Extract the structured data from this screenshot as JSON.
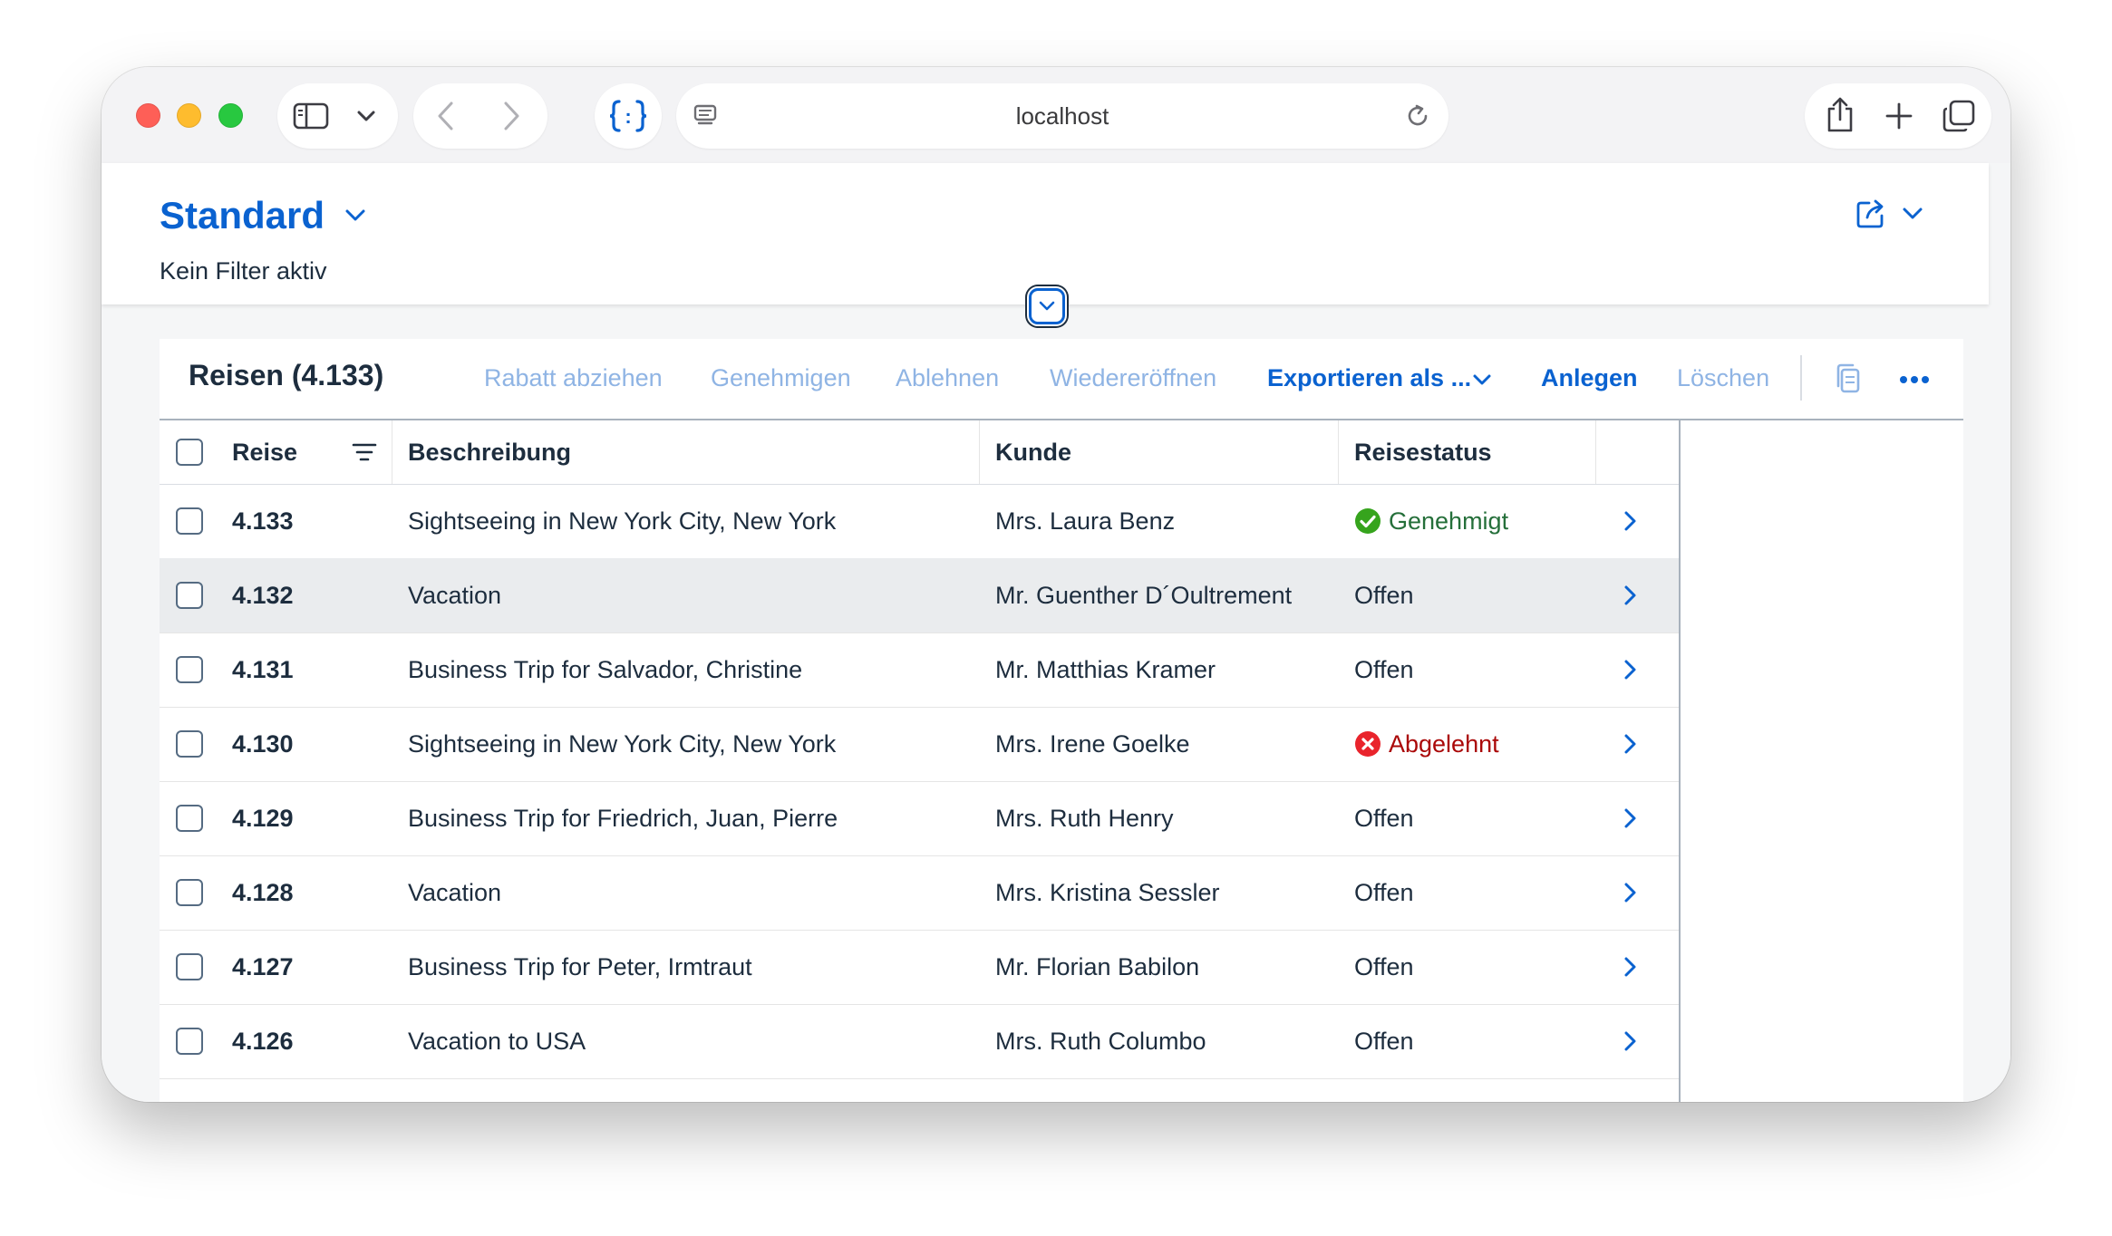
{
  "browser": {
    "address": "localhost"
  },
  "header": {
    "variant_title": "Standard",
    "filter_status": "Kein Filter aktiv"
  },
  "table": {
    "title": "Reisen (4.133)",
    "actions": {
      "discount": "Rabatt abziehen",
      "approve": "Genehmigen",
      "reject": "Ablehnen",
      "reopen": "Wiedereröffnen",
      "export": "Exportieren als ...",
      "create": "Anlegen",
      "delete": "Löschen"
    },
    "columns": {
      "trip": "Reise",
      "description": "Beschreibung",
      "customer": "Kunde",
      "status": "Reisestatus"
    },
    "rows": [
      {
        "id": "4.133",
        "description": "Sightseeing in New York City, New York",
        "customer": "Mrs. Laura Benz",
        "status": "Genehmigt",
        "status_type": "positive"
      },
      {
        "id": "4.132",
        "description": "Vacation",
        "customer": "Mr. Guenther D´Oultrement",
        "status": "Offen",
        "status_type": "neutral"
      },
      {
        "id": "4.131",
        "description": "Business Trip for Salvador, Christine",
        "customer": "Mr. Matthias Kramer",
        "status": "Offen",
        "status_type": "neutral"
      },
      {
        "id": "4.130",
        "description": "Sightseeing in New York City, New York",
        "customer": "Mrs. Irene Goelke",
        "status": "Abgelehnt",
        "status_type": "negative"
      },
      {
        "id": "4.129",
        "description": "Business Trip for Friedrich, Juan, Pierre",
        "customer": "Mrs. Ruth Henry",
        "status": "Offen",
        "status_type": "neutral"
      },
      {
        "id": "4.128",
        "description": "Vacation",
        "customer": "Mrs. Kristina Sessler",
        "status": "Offen",
        "status_type": "neutral"
      },
      {
        "id": "4.127",
        "description": "Business Trip for Peter, Irmtraut",
        "customer": "Mr. Florian Babilon",
        "status": "Offen",
        "status_type": "neutral"
      },
      {
        "id": "4.126",
        "description": "Vacation to USA",
        "customer": "Mrs. Ruth Columbo",
        "status": "Offen",
        "status_type": "neutral"
      }
    ]
  },
  "colors": {
    "brand": "#0a62d0",
    "positive": "#256f3a",
    "negative": "#aa0808"
  }
}
